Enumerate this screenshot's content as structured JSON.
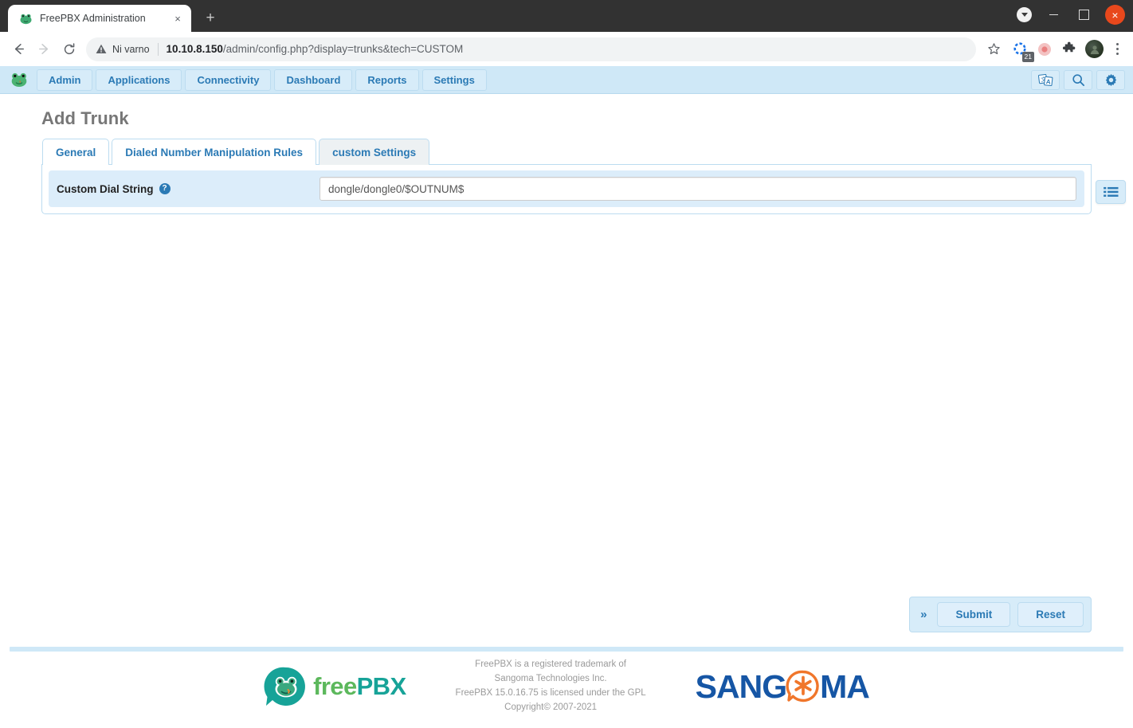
{
  "browser": {
    "tab": {
      "title": "FreePBX Administration",
      "favicon": "frog-favicon",
      "close": "×"
    },
    "new_tab": "+",
    "window_controls": {
      "chevron": "chevron-down",
      "minimize": "—",
      "maximize": "□",
      "close": "×"
    },
    "nav": {
      "back": "←",
      "forward": "→",
      "reload": "⟳"
    },
    "omnibox": {
      "security_label": "Ni varno",
      "url_domain": "10.10.8.150",
      "url_path": "/admin/config.php?display=trunks&tech=CUSTOM",
      "star": "☆"
    },
    "extensions": [
      {
        "name": "sync-extension-icon",
        "badge": "21"
      },
      {
        "name": "record-extension-icon",
        "badge": ""
      },
      {
        "name": "puzzle-extensions-icon",
        "badge": ""
      }
    ],
    "profile": "avatar",
    "menu": "kebab-menu"
  },
  "fpbx_nav": {
    "logo": "freepbx-frog-logo",
    "items": [
      {
        "label": "Admin"
      },
      {
        "label": "Applications"
      },
      {
        "label": "Connectivity"
      },
      {
        "label": "Dashboard"
      },
      {
        "label": "Reports"
      },
      {
        "label": "Settings"
      }
    ],
    "right_icons": [
      {
        "name": "translate-icon"
      },
      {
        "name": "search-icon"
      },
      {
        "name": "gear-icon"
      }
    ]
  },
  "page": {
    "title": "Add Trunk",
    "tabs": [
      {
        "label": "General",
        "active": false
      },
      {
        "label": "Dialed Number Manipulation Rules",
        "active": false
      },
      {
        "label": "custom Settings",
        "active": true
      }
    ],
    "form": {
      "field_label": "Custom Dial String",
      "help_icon": "?",
      "field_value": "dongle/dongle0/$OUTNUM$",
      "field_placeholder": "Custom Dial String"
    },
    "side_button": "list-view-icon",
    "actions": {
      "more": "»",
      "submit": "Submit",
      "reset": "Reset"
    }
  },
  "footer": {
    "logo_free": "free",
    "logo_pbx": "PBX",
    "line1": "FreePBX is a registered trademark of",
    "line2": "Sangoma Technologies Inc.",
    "line3": "FreePBX 15.0.16.75 is licensed under the GPL",
    "line4": "Copyright© 2007-2021",
    "sangoma_pre": "SANG",
    "sangoma_post": "MA"
  },
  "colors": {
    "accent": "#2b7ab5",
    "nav_bg": "#cfe8f7",
    "row_bg": "#dcedfa",
    "brand_teal": "#17a398",
    "brand_green": "#5cb85c",
    "sangoma_blue": "#1656a5",
    "sangoma_orange": "#f0762b"
  }
}
